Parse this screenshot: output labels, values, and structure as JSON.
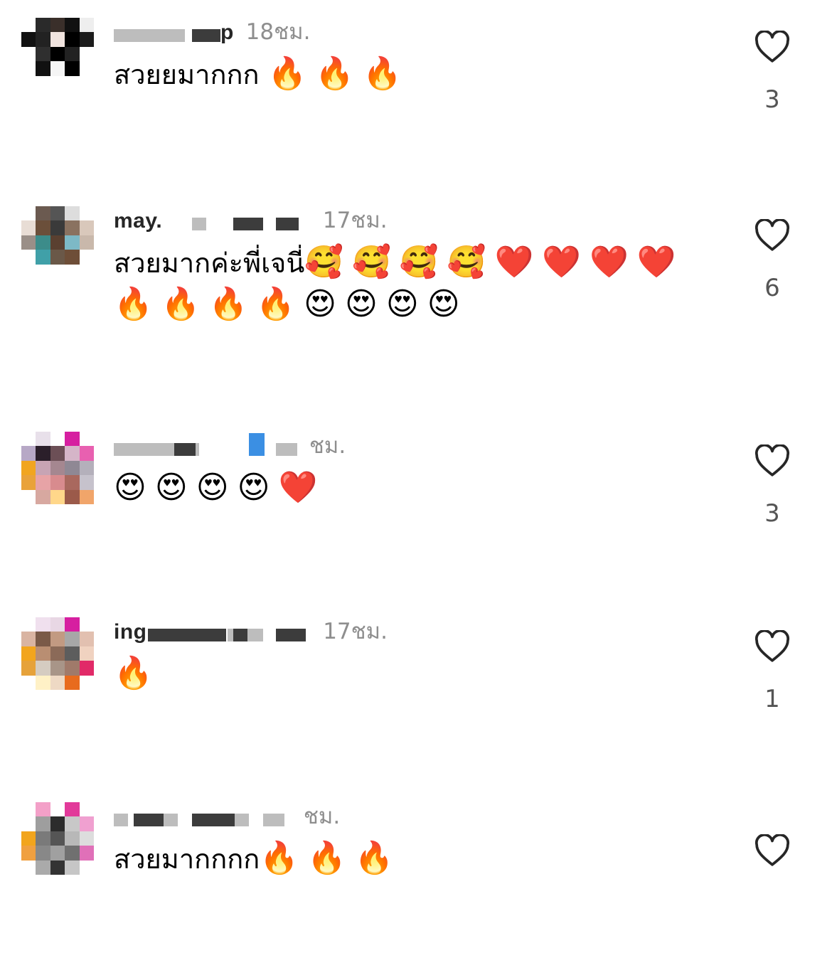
{
  "comments": [
    {
      "username": "p",
      "time": "18ชม.",
      "text": "สวยยมากกก",
      "emojis": "🔥🔥🔥",
      "likes": "3"
    },
    {
      "username": "may.",
      "time": "17ชม.",
      "text": "สวยมากค่ะพี่เจนี่",
      "emojis": "🥰🥰🥰🥰❤️❤️❤️❤️🔥🔥🔥🔥😍😍😍😍",
      "likes": "6"
    },
    {
      "username": "",
      "time": "ชม.",
      "text": "",
      "emojis": "😍😍😍😍❤️",
      "likes": "3"
    },
    {
      "username": "ing",
      "time": "17ชม.",
      "text": "",
      "emojis": "🔥",
      "likes": "1"
    },
    {
      "username": "",
      "time": "ชม.",
      "text": "สวยมากกกก",
      "emojis": "🔥🔥🔥",
      "likes": ""
    }
  ],
  "icons": {
    "like": "heart-outline-icon"
  },
  "colors": {
    "username": "#262626",
    "time": "#8e8e8e",
    "like_count": "#555555"
  }
}
